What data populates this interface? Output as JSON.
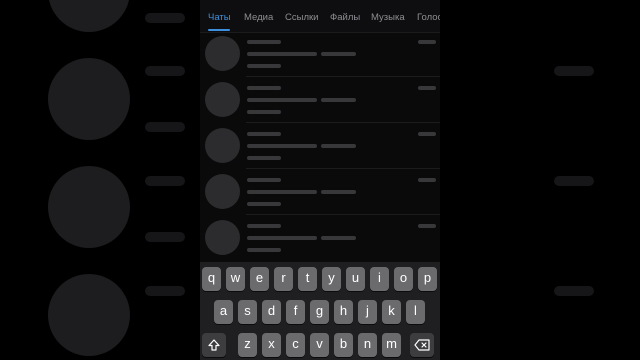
{
  "tabs": [
    {
      "label": "Чаты",
      "active": true
    },
    {
      "label": "Медиа"
    },
    {
      "label": "Ссылки"
    },
    {
      "label": "Файлы"
    },
    {
      "label": "Музыка"
    },
    {
      "label": "Голос"
    }
  ],
  "keyboard": {
    "row1": [
      "q",
      "w",
      "e",
      "r",
      "t",
      "y",
      "u",
      "i",
      "o",
      "p"
    ],
    "row2": [
      "a",
      "s",
      "d",
      "f",
      "g",
      "h",
      "j",
      "k",
      "l"
    ],
    "row3": [
      "z",
      "x",
      "c",
      "v",
      "b",
      "n",
      "m"
    ],
    "shift_icon": "shift-icon",
    "backspace_icon": "backspace-icon"
  },
  "colors": {
    "accent": "#3d8fe0",
    "background": "#000000",
    "key": "#6b6b6e"
  }
}
